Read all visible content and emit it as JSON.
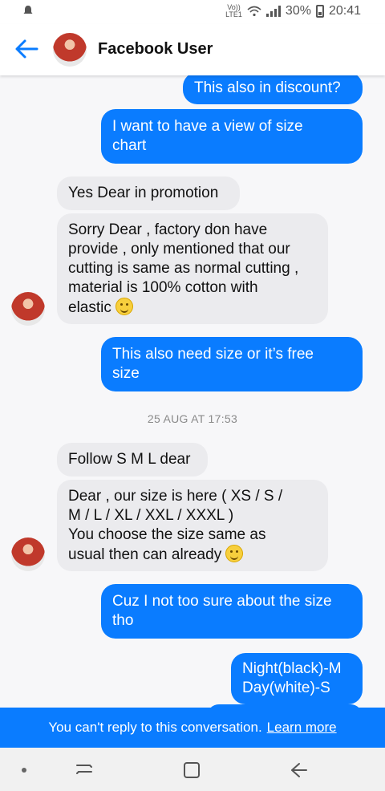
{
  "status_bar": {
    "network_top": "Vo))",
    "network_bottom": "LTE1",
    "battery": "30%",
    "time": "20:41"
  },
  "header": {
    "contact_name": "Facebook User"
  },
  "messages": [
    {
      "text": "This also in discount?"
    },
    {
      "text": "I want to have a view of size\nchart"
    },
    {
      "text": "Yes Dear in promotion"
    },
    {
      "text": "Sorry Dear , factory don have\nprovide , only mentioned that our\ncutting is same as normal cutting ,\nmaterial is 100% cotton with\nelastic",
      "emoji": "smiling-face-emoji"
    },
    {
      "text": "This also need size or it’s free\nsize"
    },
    {
      "text": "Follow S M L dear"
    },
    {
      "text": "Dear , our size is here ( XS / S /\nM / L / XL / XXL / XXXL )\nYou choose the size same as\nusual then can already",
      "emoji": "grinning-face-emoji"
    },
    {
      "text": "Cuz I not too sure about the size\ntho"
    },
    {
      "text": "Night(black)-M\nDay(white)-S"
    }
  ],
  "timestamp": "25 AUG AT 17:53",
  "banner": {
    "text": "You can't reply to this conversation.",
    "link": "Learn more"
  },
  "colors": {
    "outgoing": "#0a7cff",
    "incoming": "#ebebee",
    "accent": "#0a7cff"
  }
}
